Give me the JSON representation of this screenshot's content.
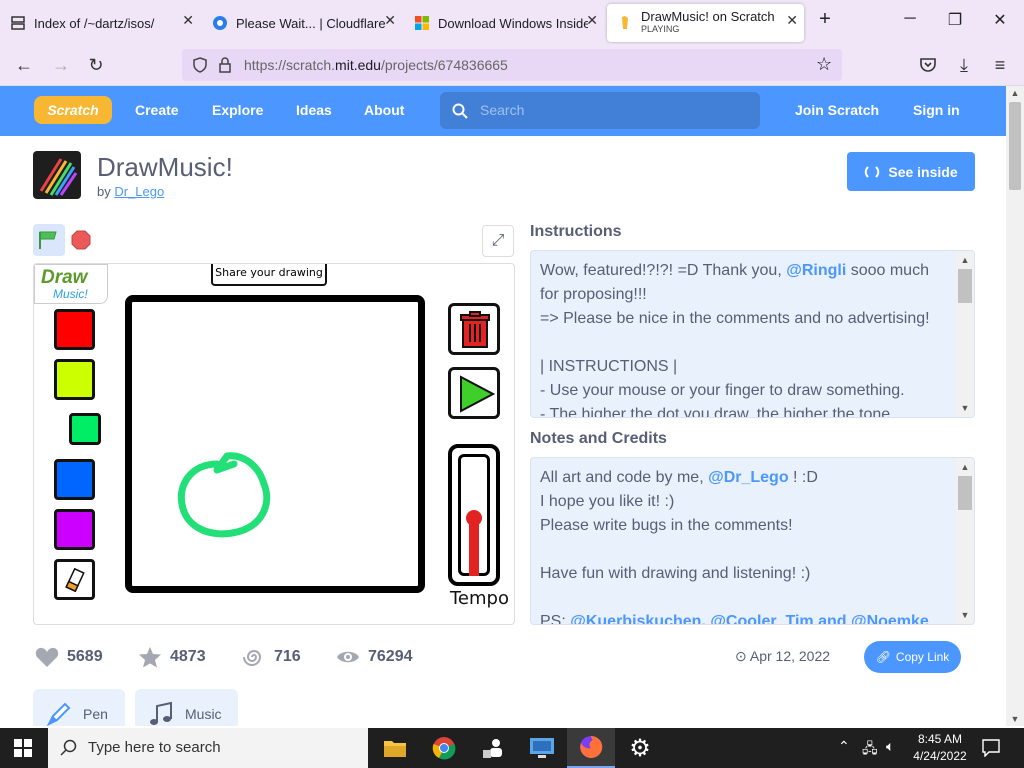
{
  "browser": {
    "tabs": [
      {
        "title": "Index of /~dartz/isos/",
        "subtitle": ""
      },
      {
        "title": "Please Wait... | Cloudflare",
        "subtitle": ""
      },
      {
        "title": "Download Windows Insider",
        "subtitle": ""
      },
      {
        "title": "DrawMusic! on Scratch",
        "subtitle": "PLAYING"
      }
    ],
    "new_tab": "+",
    "url_prefix": "https://scratch.",
    "url_domain": "mit.edu",
    "url_path": "/projects/674836665"
  },
  "scratch_nav": {
    "logo": "Scratch",
    "links": [
      "Create",
      "Explore",
      "Ideas",
      "About"
    ],
    "search_placeholder": "Search",
    "join": "Join Scratch",
    "signin": "Sign in"
  },
  "project": {
    "title": "DrawMusic!",
    "by_label": "by",
    "author": "Dr_Lego",
    "see_inside": "See inside",
    "stage": {
      "logo_line1": "Draw",
      "logo_line2": "Music!",
      "share_button": "Share your drawing",
      "tempo_label": "Tempo",
      "palette_colors": [
        "#ff0000",
        "#ccff00",
        "#00ee66",
        "#0066ff",
        "#cc00ff"
      ]
    },
    "instructions_label": "Instructions",
    "instructions": [
      {
        "text": "Wow, featured!?!?! =D Thank you, ",
        "mention": "@Ringli",
        "after": " sooo much"
      },
      {
        "text": "for proposing!!!",
        "mention": "",
        "after": ""
      },
      {
        "text": "=> Please be nice in the comments and no advertising!",
        "mention": "",
        "after": ""
      },
      {
        "text": "",
        "mention": "",
        "after": ""
      },
      {
        "text": "| INSTRUCTIONS |",
        "mention": "",
        "after": ""
      },
      {
        "text": "- Use your mouse or your finger to draw something.",
        "mention": "",
        "after": ""
      },
      {
        "text": "- The higher the dot you draw, the higher the tone.",
        "mention": "",
        "after": ""
      }
    ],
    "notes_label": "Notes and Credits",
    "notes": [
      {
        "text": "All art and code by me, ",
        "mention": "@Dr_Lego",
        "after": " ! :D"
      },
      {
        "text": "I hope you like it! :)",
        "mention": "",
        "after": ""
      },
      {
        "text": "Please write bugs in the comments!",
        "mention": "",
        "after": ""
      },
      {
        "text": "",
        "mention": "",
        "after": ""
      },
      {
        "text": "Have fun with drawing and listening! :)",
        "mention": "",
        "after": ""
      },
      {
        "text": "",
        "mention": "",
        "after": ""
      },
      {
        "text": "PS: ",
        "mention": "@Kuerbiskuchen",
        "after": ", @Cooler_Tim and @Noemke"
      }
    ],
    "stats": {
      "loves": "5689",
      "favorites": "4873",
      "remixes": "716",
      "views": "76294"
    },
    "date": "Apr 12, 2022",
    "copy_link": "Copy Link",
    "extensions": [
      "Pen",
      "Music"
    ]
  },
  "taskbar": {
    "search_placeholder": "Type here to search",
    "time": "8:45 AM",
    "date": "4/24/2022"
  }
}
